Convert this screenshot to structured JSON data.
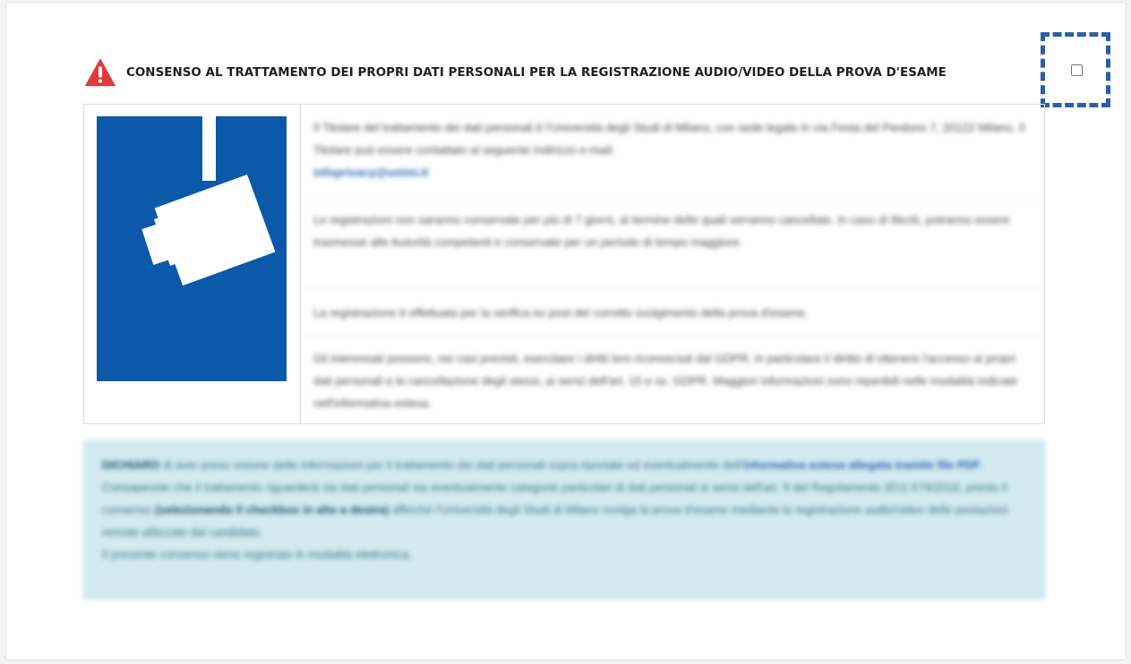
{
  "consent": {
    "title": "CONSENSO AL TRATTAMENTO DEI PROPRI DATI PERSONALI PER LA REGISTRAZIONE AUDIO/VIDEO DELLA PROVA D'ESAME",
    "checkbox_checked": false
  },
  "icons": {
    "warning": "warning-triangle-icon",
    "camera": "surveillance-camera-icon"
  },
  "colors": {
    "warning": "#e03a3e",
    "camera_bg": "#0b59a8",
    "focus_border": "#2a5fa8",
    "info_bg": "#d2eaf0",
    "link": "#2b62b0"
  },
  "info_rows": {
    "row1_text": "Il Titolare del trattamento dei dati personali è l'Università degli Studi di Milano, con sede legale in via Festa del Perdono 7, 20122 Milano. Il Titolare può essere contattato al seguente indirizzo e-mail:",
    "row1_link": "infoprivacy@unimi.it",
    "row2_text": "Le registrazioni non saranno conservate per più di 7 giorni, al termine delle quali verranno cancellate. In caso di illeciti, potranno essere trasmesse alle Autorità competenti e conservate per un periodo di tempo maggiore.",
    "row3_text": "La registrazione è effettuata per la verifica ex post del corretto svolgimento della prova d'esame.",
    "row4_text": "Gli interessati possono, nei casi previsti, esercitare i diritti loro riconosciuti dal GDPR, in particolare il diritto di ottenere l'accesso ai propri dati personali e la cancellazione degli stessi, ai sensi dell'art. 15 e ss. GDPR. Maggiori informazioni sono reperibili nelle modalità indicate nell'informativa estesa."
  },
  "declaration": {
    "bold_lead": "DICHIARO",
    "line1_rest": "di aver preso visione delle informazioni per il trattamento dei dati personali sopra riportate ed eventualmente dell'",
    "pdf_link": "informativa estesa allegata tramite file PDF",
    "line2": "Consapevole che il trattamento riguarderà sia dati personali sia eventualmente categorie particolari di dati personali ai sensi dell'art. 9 del Regolamento (EU) 679/2016, presto il consenso",
    "line2_bold": "(selezionando il checkbox in alto a destra)",
    "line2_rest": "affinché l'Università degli Studi di Milano svolga la prova d'esame mediante la registrazione audio/video delle postazioni remote utilizzate dal candidato.",
    "line3": "Il presente consenso viene registrato in modalità elettronica."
  }
}
